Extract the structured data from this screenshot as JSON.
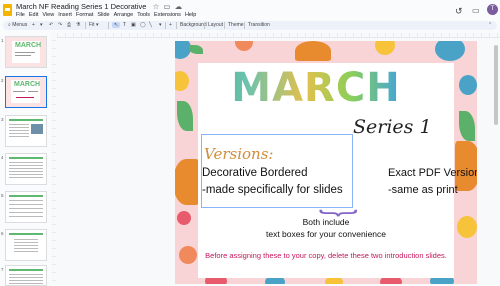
{
  "app": {
    "title": "March NF Reading Series 1 Decorative",
    "star_icon": "☆",
    "folder_icon": "▭",
    "cloud_icon": "☁"
  },
  "menu": [
    "File",
    "Edit",
    "View",
    "Insert",
    "Format",
    "Slide",
    "Arrange",
    "Tools",
    "Extensions",
    "Help"
  ],
  "header_icons": {
    "history": "↺",
    "comment": "▭",
    "avatar": "T"
  },
  "toolbar": {
    "search": "Menus",
    "new_slide": "+",
    "undo": "↶",
    "redo": "↷",
    "print": "⎙",
    "paint": "⚗",
    "zoom": "Fit",
    "select": "↖",
    "textbox": "T",
    "image": "▣",
    "shape": "◯",
    "line": "╲",
    "comment": "+",
    "background": "Background",
    "layout": "Layout",
    "theme": "Theme",
    "transition": "Transition"
  },
  "slides_panel": {
    "numbers": [
      "1",
      "2",
      "3",
      "4",
      "5",
      "6",
      "7"
    ],
    "thumb1_title": "MARCH",
    "thumb2_title": "MARCH",
    "thumb3_title": "",
    "thumb4_title": "",
    "thumb5_title": "",
    "thumb6_title": "",
    "thumb7_title": ""
  },
  "slide": {
    "title": "MARCH",
    "series": "Series 1",
    "versions_label": "Versions:",
    "decorative_line1": "Decorative Bordered",
    "decorative_line2": "-made specifically for slides",
    "exact_line1": "Exact PDF Version",
    "exact_line2": "-same as print",
    "both_include": "Both include",
    "text_boxes": "text boxes for your convenience",
    "warning": "Before assigning these to your copy, delete these two introduction slides."
  },
  "colors": {
    "brand": "#f4b400",
    "accent": "#1a73e8",
    "slide_bg": "#f9d4d6",
    "versions": "#cf8d3b",
    "warning": "#c2185b",
    "brace": "#8367c7"
  }
}
